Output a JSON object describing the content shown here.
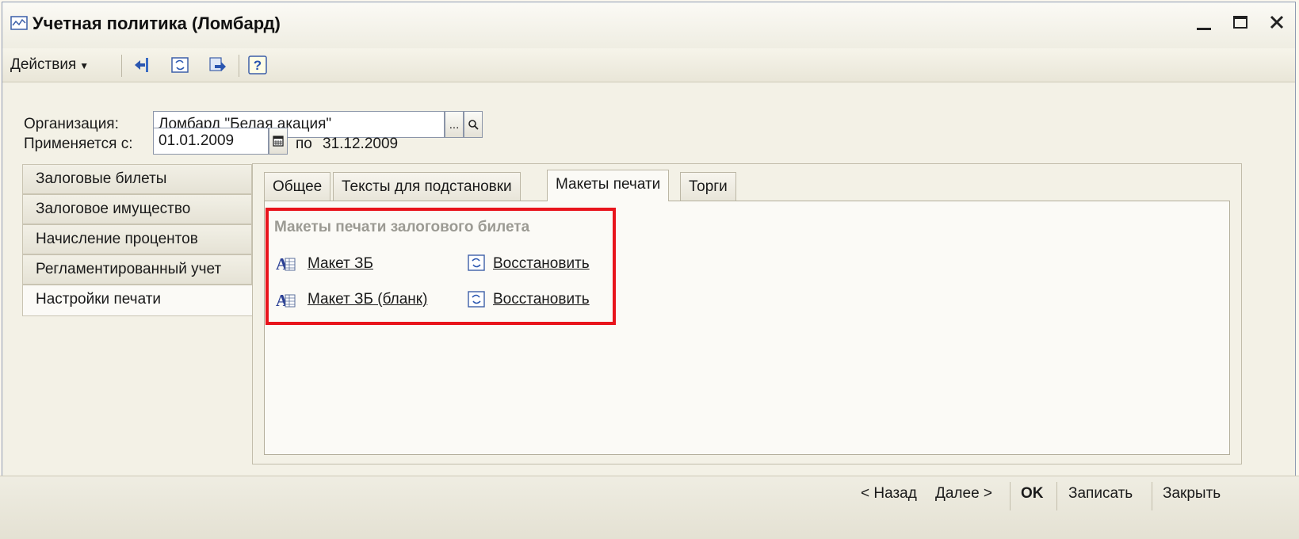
{
  "window": {
    "title": "Учетная политика (Ломбард)"
  },
  "toolbar": {
    "actions_label": "Действия",
    "icons": [
      "arrow-left-icon",
      "refresh-icon",
      "transfer-icon",
      "help-icon"
    ]
  },
  "form": {
    "organization_label": "Организация:",
    "organization_value": "Ломбард \"Белая акация\"",
    "applies_from_label": "Применяется с:",
    "applies_from_value": "01.01.2009",
    "applies_to_label": "по",
    "applies_to_value": "31.12.2009"
  },
  "left_tabs": [
    {
      "label": "Залоговые билеты"
    },
    {
      "label": "Залоговое имущество"
    },
    {
      "label": "Начисление процентов"
    },
    {
      "label": "Регламентированный учет"
    },
    {
      "label": "Настройки печати"
    }
  ],
  "inner_tabs": [
    {
      "label": "Общее"
    },
    {
      "label": "Тексты для подстановки"
    },
    {
      "label": "Макеты печати"
    },
    {
      "label": "Торги"
    }
  ],
  "templates": {
    "group_title": "Макеты печати залогового билета",
    "rows": [
      {
        "name": "Макет ЗБ",
        "action": "Восстановить"
      },
      {
        "name": "Макет ЗБ (бланк)",
        "action": "Восстановить"
      }
    ]
  },
  "bottom": {
    "back": "< Назад",
    "next": "Далее >",
    "ok": "OK",
    "save": "Записать",
    "close": "Закрыть"
  },
  "colors": {
    "highlight": "#e8141c",
    "window_bg": "#f3f1e6"
  }
}
